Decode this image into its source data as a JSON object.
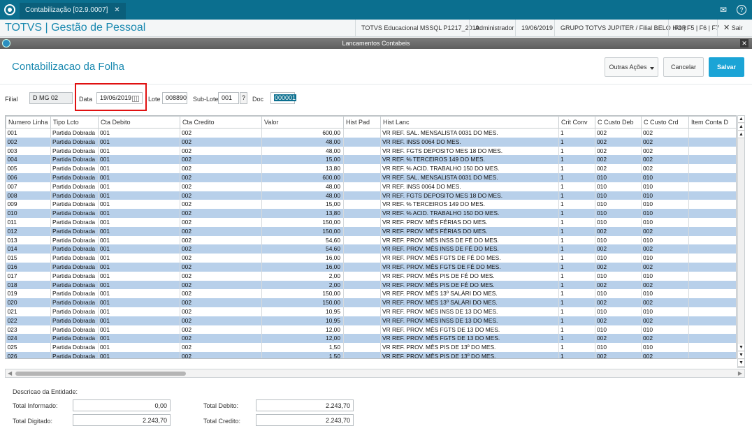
{
  "tabbar": {
    "tab_label": "Contabilização [02.9.0007]",
    "tab_close": "✕"
  },
  "header": {
    "brand": "TOTVS | Gestão de Pessoal",
    "environment": "TOTVS Educacional MSSQL P1217_2019",
    "user": "Administrador",
    "date": "19/06/2019",
    "company": "GRUPO TOTVS JUPITER / Filial BELO HOR",
    "shortcuts": "F4 | F5 | F6 | F7",
    "exit_label": "Sair"
  },
  "dialog": {
    "caption": "Lancamentos Contabeis"
  },
  "page": {
    "title": "Contabilizacao da Folha"
  },
  "actions": {
    "more": "Outras Ações",
    "cancel": "Cancelar",
    "save": "Salvar"
  },
  "form": {
    "filial_label": "Filial",
    "filial_value": "D MG 02",
    "data_label": "Data",
    "data_value": "19/06/2019",
    "lote_label": "Lote",
    "lote_value": "008890",
    "sublote_label": "Sub-Lote",
    "sublote_value": "001",
    "sublote_query": "?",
    "doc_label": "Doc",
    "doc_value": "000001"
  },
  "grid": {
    "columns": [
      "Numero Linha",
      "Tipo Lcto",
      "Cta Debito",
      "Cta Credito",
      "Valor",
      "Hist Pad",
      "Hist Lanc",
      "Crit Conv",
      "C Custo Deb",
      "C Custo Crd",
      "Item Conta D"
    ],
    "rows": [
      [
        "001",
        "Partida Dobrada",
        "001",
        "002",
        "600,00",
        "",
        "VR REF. SAL. MENSALISTA 0031 DO MES.",
        "1",
        "002",
        "002",
        ""
      ],
      [
        "002",
        "Partida Dobrada",
        "001",
        "002",
        "48,00",
        "",
        "VR REF. INSS 0064 DO MES.",
        "1",
        "002",
        "002",
        ""
      ],
      [
        "003",
        "Partida Dobrada",
        "001",
        "002",
        "48,00",
        "",
        "VR REF. FGTS DEPOSITO MES 18 DO MES.",
        "1",
        "002",
        "002",
        ""
      ],
      [
        "004",
        "Partida Dobrada",
        "001",
        "002",
        "15,00",
        "",
        "VR REF. % TERCEIROS 149 DO MES.",
        "1",
        "002",
        "002",
        ""
      ],
      [
        "005",
        "Partida Dobrada",
        "001",
        "002",
        "13,80",
        "",
        "VR REF. % ACID. TRABALHO 150 DO MES.",
        "1",
        "002",
        "002",
        ""
      ],
      [
        "006",
        "Partida Dobrada",
        "001",
        "002",
        "600,00",
        "",
        "VR REF. SAL. MENSALISTA 0031 DO MES.",
        "1",
        "010",
        "010",
        ""
      ],
      [
        "007",
        "Partida Dobrada",
        "001",
        "002",
        "48,00",
        "",
        "VR REF. INSS 0064 DO MES.",
        "1",
        "010",
        "010",
        ""
      ],
      [
        "008",
        "Partida Dobrada",
        "001",
        "002",
        "48,00",
        "",
        "VR REF. FGTS DEPOSITO MES 18 DO MES.",
        "1",
        "010",
        "010",
        ""
      ],
      [
        "009",
        "Partida Dobrada",
        "001",
        "002",
        "15,00",
        "",
        "VR REF. % TERCEIROS 149 DO MES.",
        "1",
        "010",
        "010",
        ""
      ],
      [
        "010",
        "Partida Dobrada",
        "001",
        "002",
        "13,80",
        "",
        "VR REF. % ACID. TRABALHO 150 DO MES.",
        "1",
        "010",
        "010",
        ""
      ],
      [
        "011",
        "Partida Dobrada",
        "001",
        "002",
        "150,00",
        "",
        "VR REF. PROV. MÊS FÉRIAS DO MES.",
        "1",
        "010",
        "010",
        ""
      ],
      [
        "012",
        "Partida Dobrada",
        "001",
        "002",
        "150,00",
        "",
        "VR REF. PROV. MÊS FÉRIAS DO MES.",
        "1",
        "002",
        "002",
        ""
      ],
      [
        "013",
        "Partida Dobrada",
        "001",
        "002",
        "54,60",
        "",
        "VR REF. PROV. MÊS INSS DE FÉ DO MES.",
        "1",
        "010",
        "010",
        ""
      ],
      [
        "014",
        "Partida Dobrada",
        "001",
        "002",
        "54,60",
        "",
        "VR REF. PROV. MÊS INSS DE FÉ DO MES.",
        "1",
        "002",
        "002",
        ""
      ],
      [
        "015",
        "Partida Dobrada",
        "001",
        "002",
        "16,00",
        "",
        "VR REF. PROV. MÊS FGTS DE FÉ DO MES.",
        "1",
        "010",
        "010",
        ""
      ],
      [
        "016",
        "Partida Dobrada",
        "001",
        "002",
        "16,00",
        "",
        "VR REF. PROV. MÊS FGTS DE FÉ DO MES.",
        "1",
        "002",
        "002",
        ""
      ],
      [
        "017",
        "Partida Dobrada",
        "001",
        "002",
        "2,00",
        "",
        "VR REF. PROV. MÊS PIS DE FÉ DO MES.",
        "1",
        "010",
        "010",
        ""
      ],
      [
        "018",
        "Partida Dobrada",
        "001",
        "002",
        "2,00",
        "",
        "VR REF. PROV. MÊS PIS DE FÉ DO MES.",
        "1",
        "002",
        "002",
        ""
      ],
      [
        "019",
        "Partida Dobrada",
        "001",
        "002",
        "150,00",
        "",
        "VR REF. PROV. MÊS 13º SALÁRI DO MES.",
        "1",
        "010",
        "010",
        ""
      ],
      [
        "020",
        "Partida Dobrada",
        "001",
        "002",
        "150,00",
        "",
        "VR REF. PROV. MÊS 13º SALÁRI DO MES.",
        "1",
        "002",
        "002",
        ""
      ],
      [
        "021",
        "Partida Dobrada",
        "001",
        "002",
        "10,95",
        "",
        "VR REF. PROV. MÊS INSS DE 13 DO MES.",
        "1",
        "010",
        "010",
        ""
      ],
      [
        "022",
        "Partida Dobrada",
        "001",
        "002",
        "10,95",
        "",
        "VR REF. PROV. MÊS INSS DE 13 DO MES.",
        "1",
        "002",
        "002",
        ""
      ],
      [
        "023",
        "Partida Dobrada",
        "001",
        "002",
        "12,00",
        "",
        "VR REF. PROV. MÊS FGTS DE 13 DO MES.",
        "1",
        "010",
        "010",
        ""
      ],
      [
        "024",
        "Partida Dobrada",
        "001",
        "002",
        "12,00",
        "",
        "VR REF. PROV. MÊS FGTS DE 13 DO MES.",
        "1",
        "002",
        "002",
        ""
      ],
      [
        "025",
        "Partida Dobrada",
        "001",
        "002",
        "1,50",
        "",
        "VR REF. PROV. MÊS PIS DE 13º DO MES.",
        "1",
        "010",
        "010",
        ""
      ],
      [
        "026",
        "Partida Dobrada",
        "001",
        "002",
        "1,50",
        "",
        "VR REF. PROV. MÊS PIS DE 13º DO MES.",
        "1",
        "002",
        "002",
        ""
      ]
    ]
  },
  "footer": {
    "desc_label": "Descricao da Entidade:",
    "total_informado_label": "Total Informado:",
    "total_informado": "0,00",
    "total_digitado_label": "Total Digitado:",
    "total_digitado": "2.243,70",
    "total_debito_label": "Total Debito:",
    "total_debito": "2.243,70",
    "total_credito_label": "Total Credito:",
    "total_credito": "2.243,70"
  },
  "colors": {
    "brand": "#1a89b0",
    "titlebar": "#0b6f8f",
    "primary_button": "#1ba4d6",
    "alt_row": "#b8d0ea",
    "highlight": "#e01010"
  }
}
